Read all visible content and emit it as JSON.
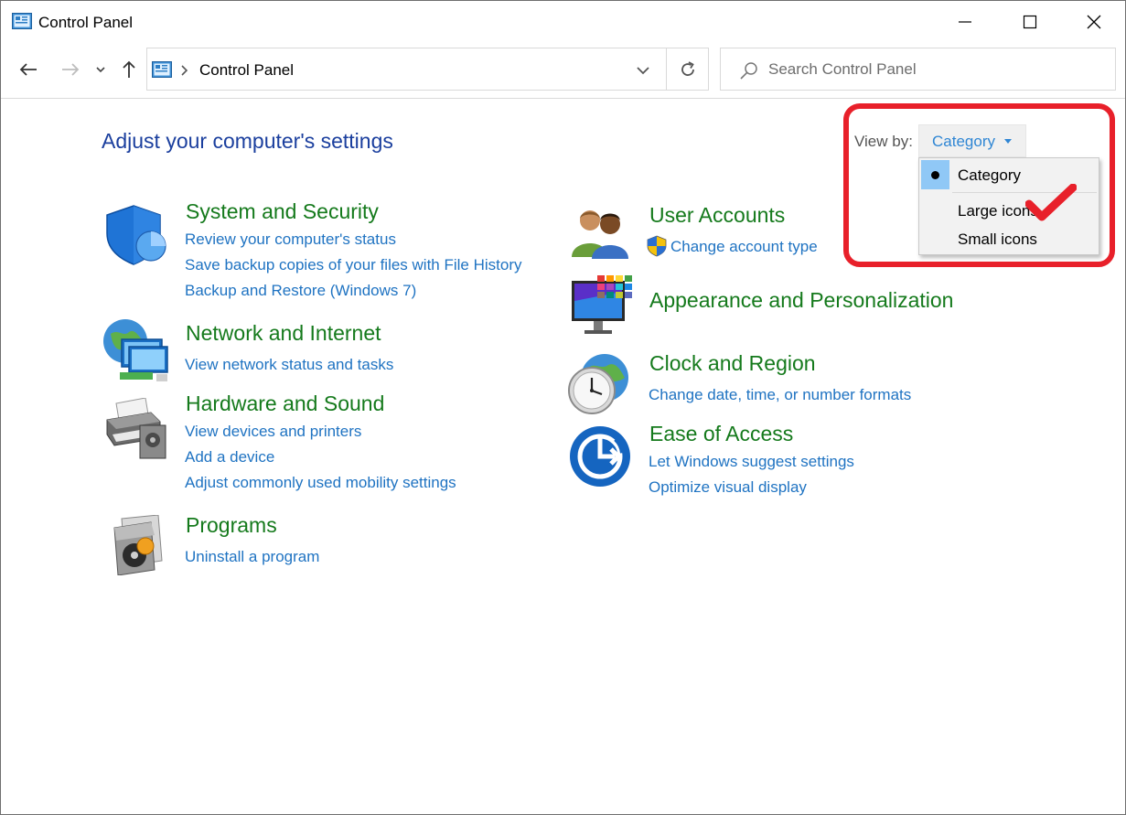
{
  "window": {
    "title": "Control Panel",
    "minimize_label": "Minimize",
    "maximize_label": "Maximize",
    "close_label": "Close"
  },
  "nav": {
    "address": "Control Panel",
    "search_placeholder": "Search Control Panel"
  },
  "page_title": "Adjust your computer's settings",
  "view_by": {
    "label": "View by:",
    "value": "Category",
    "options": [
      "Category",
      "Large icons",
      "Small icons"
    ],
    "selected": "Category"
  },
  "categories": {
    "system": {
      "title": "System and Security",
      "links": [
        "Review your computer's status",
        "Save backup copies of your files with File History",
        "Backup and Restore (Windows 7)"
      ]
    },
    "network": {
      "title": "Network and Internet",
      "links": [
        "View network status and tasks"
      ]
    },
    "hardware": {
      "title": "Hardware and Sound",
      "links": [
        "View devices and printers",
        "Add a device",
        "Adjust commonly used mobility settings"
      ]
    },
    "programs": {
      "title": "Programs",
      "links": [
        "Uninstall a program"
      ]
    },
    "users": {
      "title": "User Accounts",
      "links": [
        "Change account type"
      ]
    },
    "appearance": {
      "title": "Appearance and Personalization",
      "links": []
    },
    "clock": {
      "title": "Clock and Region",
      "links": [
        "Change date, time, or number formats"
      ]
    },
    "ease": {
      "title": "Ease of Access",
      "links": [
        "Let Windows suggest settings",
        "Optimize visual display"
      ]
    }
  },
  "colors": {
    "category_title": "#157a1c",
    "link": "#1f73c2",
    "page_title": "#1b3f9e",
    "highlight": "#e8202a"
  }
}
